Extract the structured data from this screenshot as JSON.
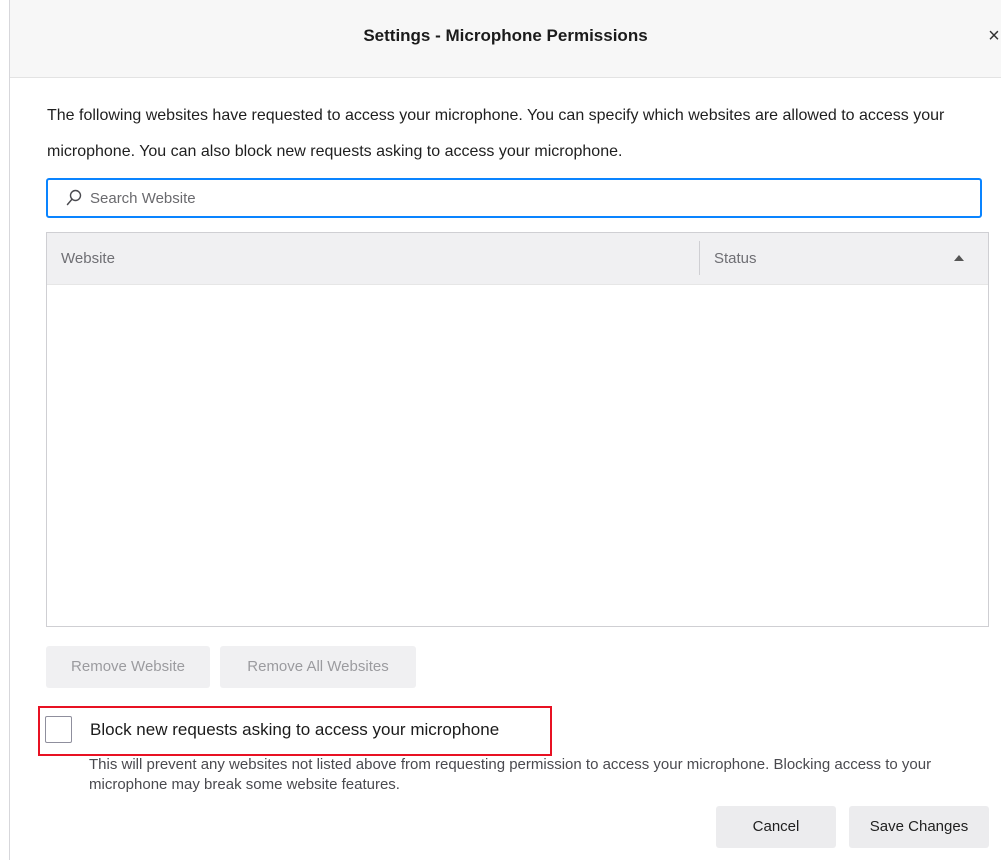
{
  "dialog": {
    "title": "Settings - Microphone Permissions",
    "close_label": "×"
  },
  "description": "The following websites have requested to access your microphone. You can specify which websites are allowed to access your microphone. You can also block new requests asking to access your microphone.",
  "search": {
    "placeholder": "Search Website",
    "value": ""
  },
  "table": {
    "columns": [
      "Website",
      "Status"
    ],
    "rows": []
  },
  "buttons": {
    "remove_website": "Remove Website",
    "remove_all": "Remove All Websites",
    "cancel": "Cancel",
    "save": "Save Changes"
  },
  "block_option": {
    "label": "Block new requests asking to access your microphone",
    "checked": false,
    "description": "This will prevent any websites not listed above from requesting permission to access your microphone. Blocking access to your microphone may break some website features."
  },
  "colors": {
    "accent": "#0a84ff",
    "highlight": "#e81123"
  },
  "icons": {
    "search": "search-icon",
    "sort": "sort-ascending-icon",
    "close": "close-icon"
  }
}
